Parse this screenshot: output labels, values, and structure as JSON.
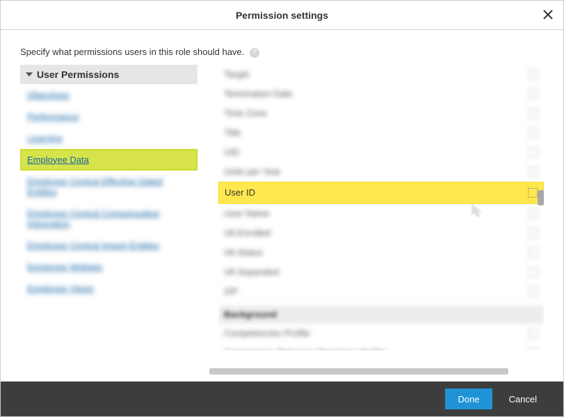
{
  "dialog": {
    "title": "Permission settings",
    "instruction": "Specify what permissions users in this role should have."
  },
  "sidebar": {
    "header": "User Permissions",
    "items": [
      {
        "label": "Objectives",
        "blurred": true
      },
      {
        "label": "Performance",
        "blurred": true
      },
      {
        "label": "Learning",
        "blurred": true
      },
      {
        "label": "Employee Data",
        "blurred": false,
        "highlight": true
      },
      {
        "label": "Employee Central Effective Dated Entities",
        "blurred": true
      },
      {
        "label": "Employee Central Compensation Integration",
        "blurred": true
      },
      {
        "label": "Employee Central Import Entities",
        "blurred": true
      },
      {
        "label": "Employee Widgets",
        "blurred": true
      },
      {
        "label": "Employee Views",
        "blurred": true
      }
    ]
  },
  "permissions": {
    "rows_before": [
      "Target",
      "Termination Date",
      "Time Zone",
      "Title",
      "UID",
      "Units per Year"
    ],
    "highlight_row": {
      "label": "User ID"
    },
    "rows_after": [
      "User Name",
      "VA Enrolled",
      "VA Status",
      "VA Separated",
      "ZIP"
    ],
    "section": {
      "header": "Background",
      "rows": [
        "Competencies Profile",
        "Competency Behavior Objectives Profile"
      ]
    }
  },
  "footer": {
    "primary": "Done",
    "secondary": "Cancel"
  }
}
